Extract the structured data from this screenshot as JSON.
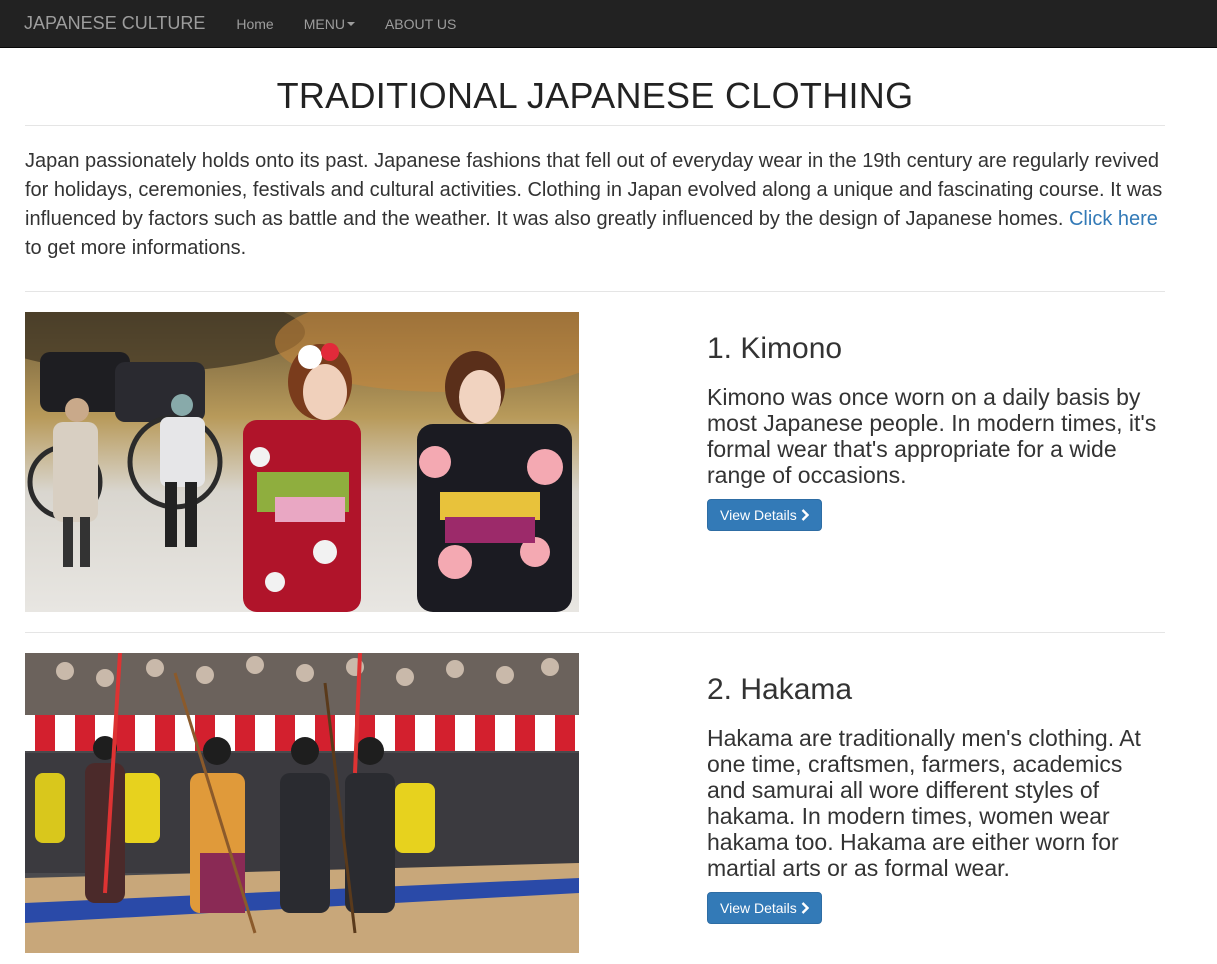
{
  "navbar": {
    "brand": "JAPANESE CULTURE",
    "links": [
      {
        "label": "Home"
      },
      {
        "label": "MENU",
        "has_caret": true
      },
      {
        "label": "ABOUT US"
      }
    ]
  },
  "page": {
    "title": "TRADITIONAL JAPANESE CLOTHING",
    "intro_text": "Japan passionately holds onto its past. Japanese fashions that fell out of everyday wear in the 19th century are regularly revived for holidays, ceremonies, festivals and cultural activities. Clothing in Japan evolved along a unique and fascinating course. It was influenced by factors such as battle and the weather. It was also greatly influenced by the design of Japanese homes.",
    "intro_link": "Click here",
    "intro_tail": "to get more informations."
  },
  "features": [
    {
      "heading": "1. Kimono",
      "text": "Kimono was once worn on a daily basis by most Japanese people. In modern times, it's formal wear that's appropriate for a wide range of occasions.",
      "button": "View Details",
      "button_icon": "chevron-right-icon"
    },
    {
      "heading": "2. Hakama",
      "text": "Hakama are traditionally men's clothing. At one time, craftsmen, farmers, academics and samurai all wore different styles of hakama. In modern times, women wear hakama too. Hakama are either worn for martial arts or as formal wear.",
      "button": "View Details",
      "button_icon": "chevron-right-icon"
    }
  ],
  "colors": {
    "navbar_bg": "#222222",
    "navbar_text": "#9d9d9d",
    "link": "#337ab7",
    "button": "#337ab7"
  }
}
